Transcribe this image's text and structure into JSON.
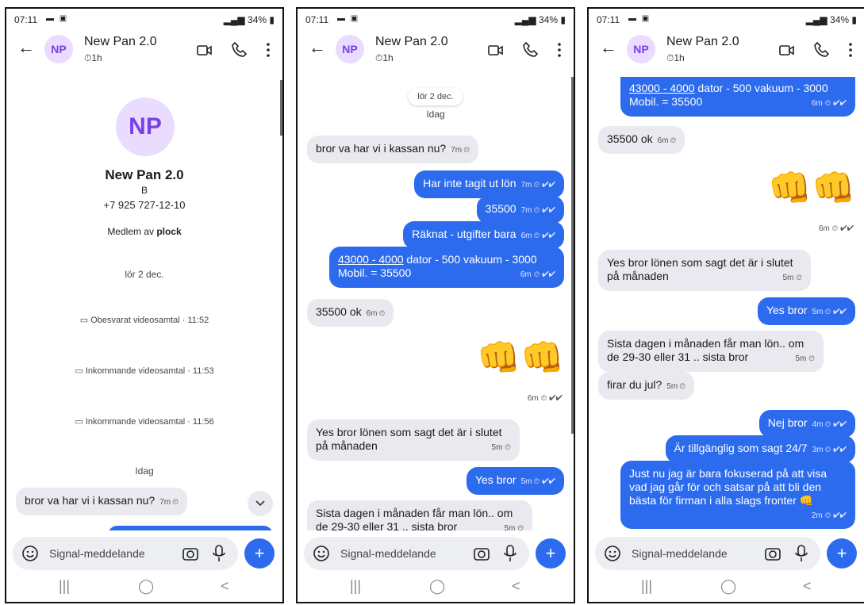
{
  "status": {
    "time": "07:11",
    "battery": "34%"
  },
  "contact": {
    "initials": "NP",
    "name": "New Pan 2.0",
    "timer": "1h",
    "profile_symbol": "B",
    "phone": "+7 925 727-12-10",
    "member_prefix": "Medlem av",
    "group": "plock"
  },
  "icons": {
    "back": "arrow-left-icon",
    "video": "video-camera-icon",
    "call": "phone-icon",
    "more": "more-vertical-icon",
    "emoji": "smiley-icon",
    "camera": "camera-icon",
    "mic": "microphone-icon",
    "plus": "plus-icon",
    "scroll": "chevron-down-icon"
  },
  "colors": {
    "outgoing": "#2c6bed",
    "incoming": "#e9e9ef",
    "avatar_bg": "#e9dcff",
    "avatar_fg": "#7b3fe6"
  },
  "composer": {
    "placeholder": "Signal-meddelande",
    "plus": "+"
  },
  "nav": {
    "recent": "|||",
    "home": "◯",
    "back": "<"
  },
  "phone1": {
    "date": "lör 2 dec.",
    "calls": [
      "Obesvarat videosamtal · 11:52",
      "Inkommande videosamtal · 11:53",
      "Inkommande videosamtal · 11:56"
    ],
    "today": "Idag",
    "msg": {
      "text": "bror va har vi i kassan nu?",
      "time": "7m"
    }
  },
  "phone2": {
    "date_pill": "lör 2 dec.",
    "today": "Idag",
    "messages": [
      {
        "text": "bror va har vi i kassan nu?",
        "time": "7m"
      },
      {
        "text": "Har inte tagit ut lön",
        "time": "7m"
      },
      {
        "text": "35500",
        "time": "7m"
      },
      {
        "text": "Räknat - utgifter bara",
        "time": "6m"
      },
      {
        "link": "43000 - 4000",
        "text_a": " dator - 500 vakuum - 3000",
        "text_b": "Mobil. = 35500",
        "time": "6m"
      },
      {
        "text": "35500 ok",
        "time": "6m"
      },
      {
        "emoji": "👊👊",
        "time": "6m"
      },
      {
        "text_a": "Yes bror lönen som sagt det är i slutet",
        "text_b": "på månaden",
        "time": "5m"
      },
      {
        "text": "Yes bror",
        "time": "5m"
      },
      {
        "text_a": "Sista dagen i månaden får man lön.. om",
        "text_b": "de 29-30 eller 31 .. sista bror",
        "time": "5m"
      }
    ]
  },
  "phone3": {
    "messages": [
      {
        "link": "43000 - 4000",
        "text_a": " dator - 500 vakuum - 3000",
        "text_b": "Mobil. = 35500",
        "time": "6m"
      },
      {
        "text": "35500 ok",
        "time": "6m"
      },
      {
        "emoji": "👊👊",
        "time": "6m"
      },
      {
        "text_a": "Yes bror lönen som sagt det är i slutet",
        "text_b": "på månaden",
        "time": "5m"
      },
      {
        "text": "Yes bror",
        "time": "5m"
      },
      {
        "text_a": "Sista dagen i månaden får man lön.. om",
        "text_b": "de 29-30 eller 31 .. sista bror",
        "time": "5m"
      },
      {
        "text": "firar du jul?",
        "time": "5m"
      },
      {
        "text": "Nej bror",
        "time": "4m"
      },
      {
        "text": "Är tillgänglig som sagt 24/7",
        "time": "3m"
      },
      {
        "text_a": "Just nu jag är bara fokuserad på att visa",
        "text_b": "vad jag går för och satsar på att bli den",
        "text_c": "bästa för firman i alla slags fronter 👊",
        "time": "2m"
      }
    ]
  }
}
